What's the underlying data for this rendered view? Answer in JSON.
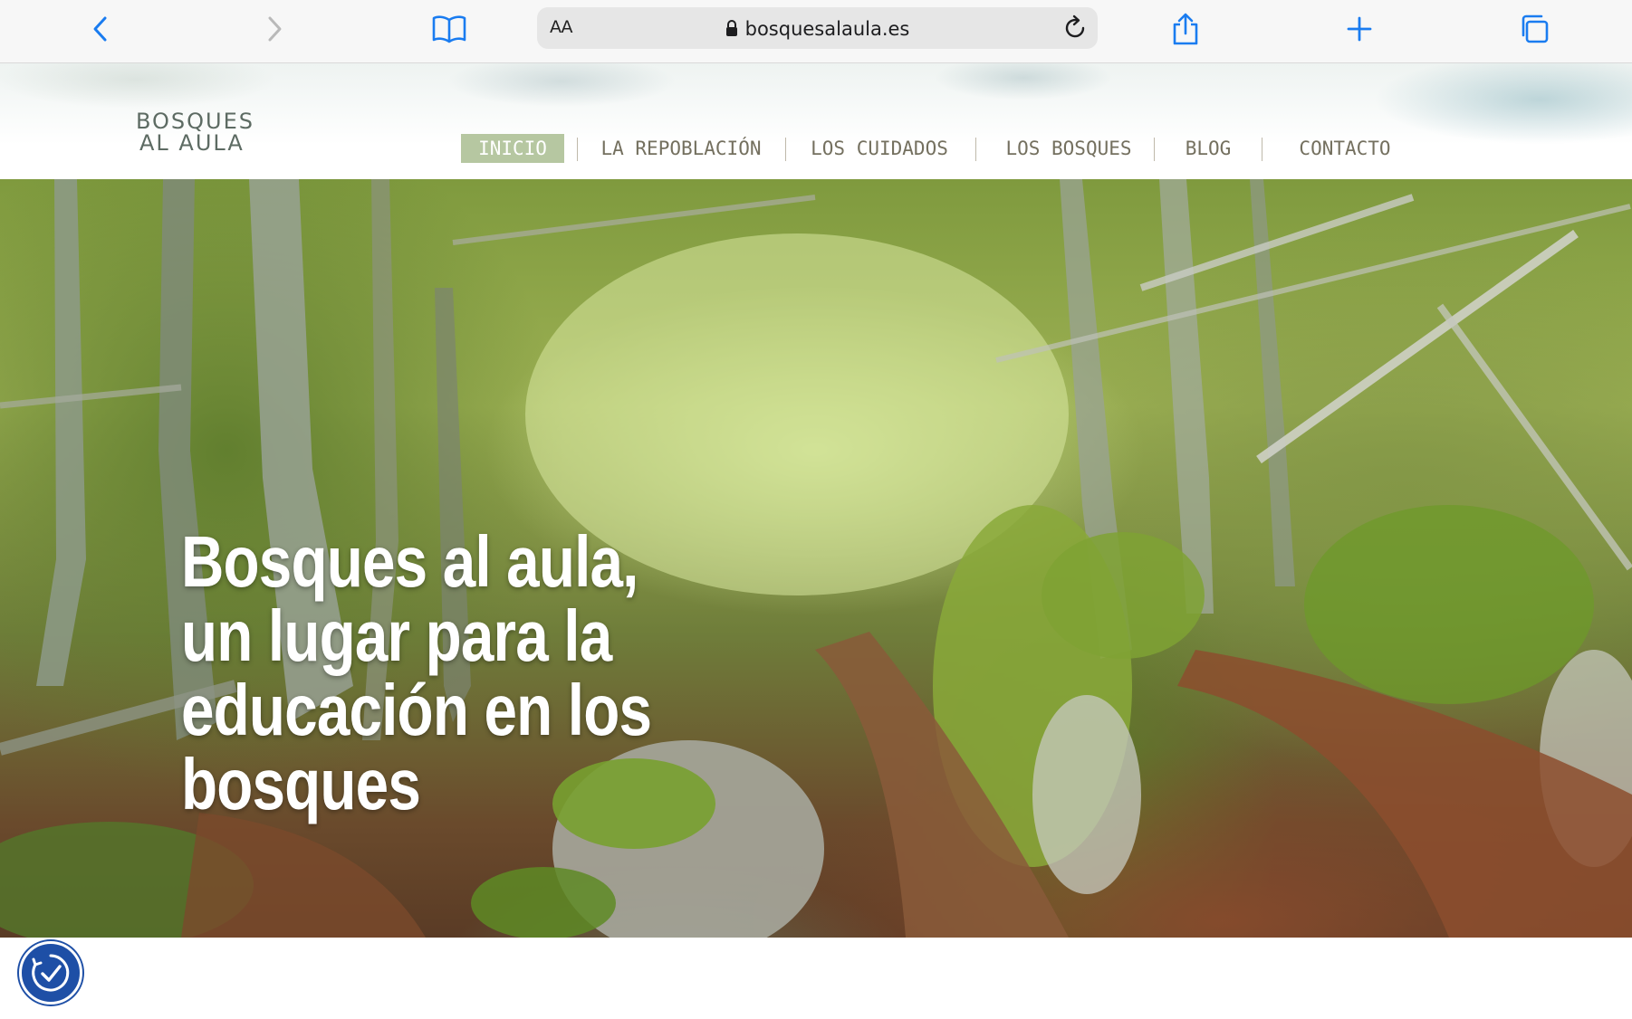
{
  "browser": {
    "address": {
      "text_size_label": "AA",
      "url": "bosquesalaula.es"
    },
    "icons": {
      "back": "chevron-left-icon",
      "forward": "chevron-right-icon",
      "bookmarks": "book-icon",
      "lock": "lock-icon",
      "reload": "reload-icon",
      "share": "share-icon",
      "new_tab": "plus-icon",
      "tabs": "tabs-icon"
    },
    "accent_color": "#1a7cf0"
  },
  "site": {
    "logo": {
      "line1": "BOSQUES",
      "line2": "AL AULA"
    },
    "nav": [
      {
        "label": "INICIO",
        "active": true
      },
      {
        "label": "LA REPOBLACIÓN",
        "active": false
      },
      {
        "label": "LOS CUIDADOS",
        "active": false
      },
      {
        "label": "LOS BOSQUES",
        "active": false
      },
      {
        "label": "BLOG",
        "active": false
      },
      {
        "label": "CONTACTO",
        "active": false
      }
    ],
    "nav_active_color": "#b6c7a1",
    "hero": {
      "lines": [
        "Bosques al aula,",
        "un lugar para la",
        "educación en los",
        "bosques"
      ]
    },
    "accessibility_button": {
      "icon": "accessibility-icon",
      "color": "#1e4fa6"
    }
  }
}
